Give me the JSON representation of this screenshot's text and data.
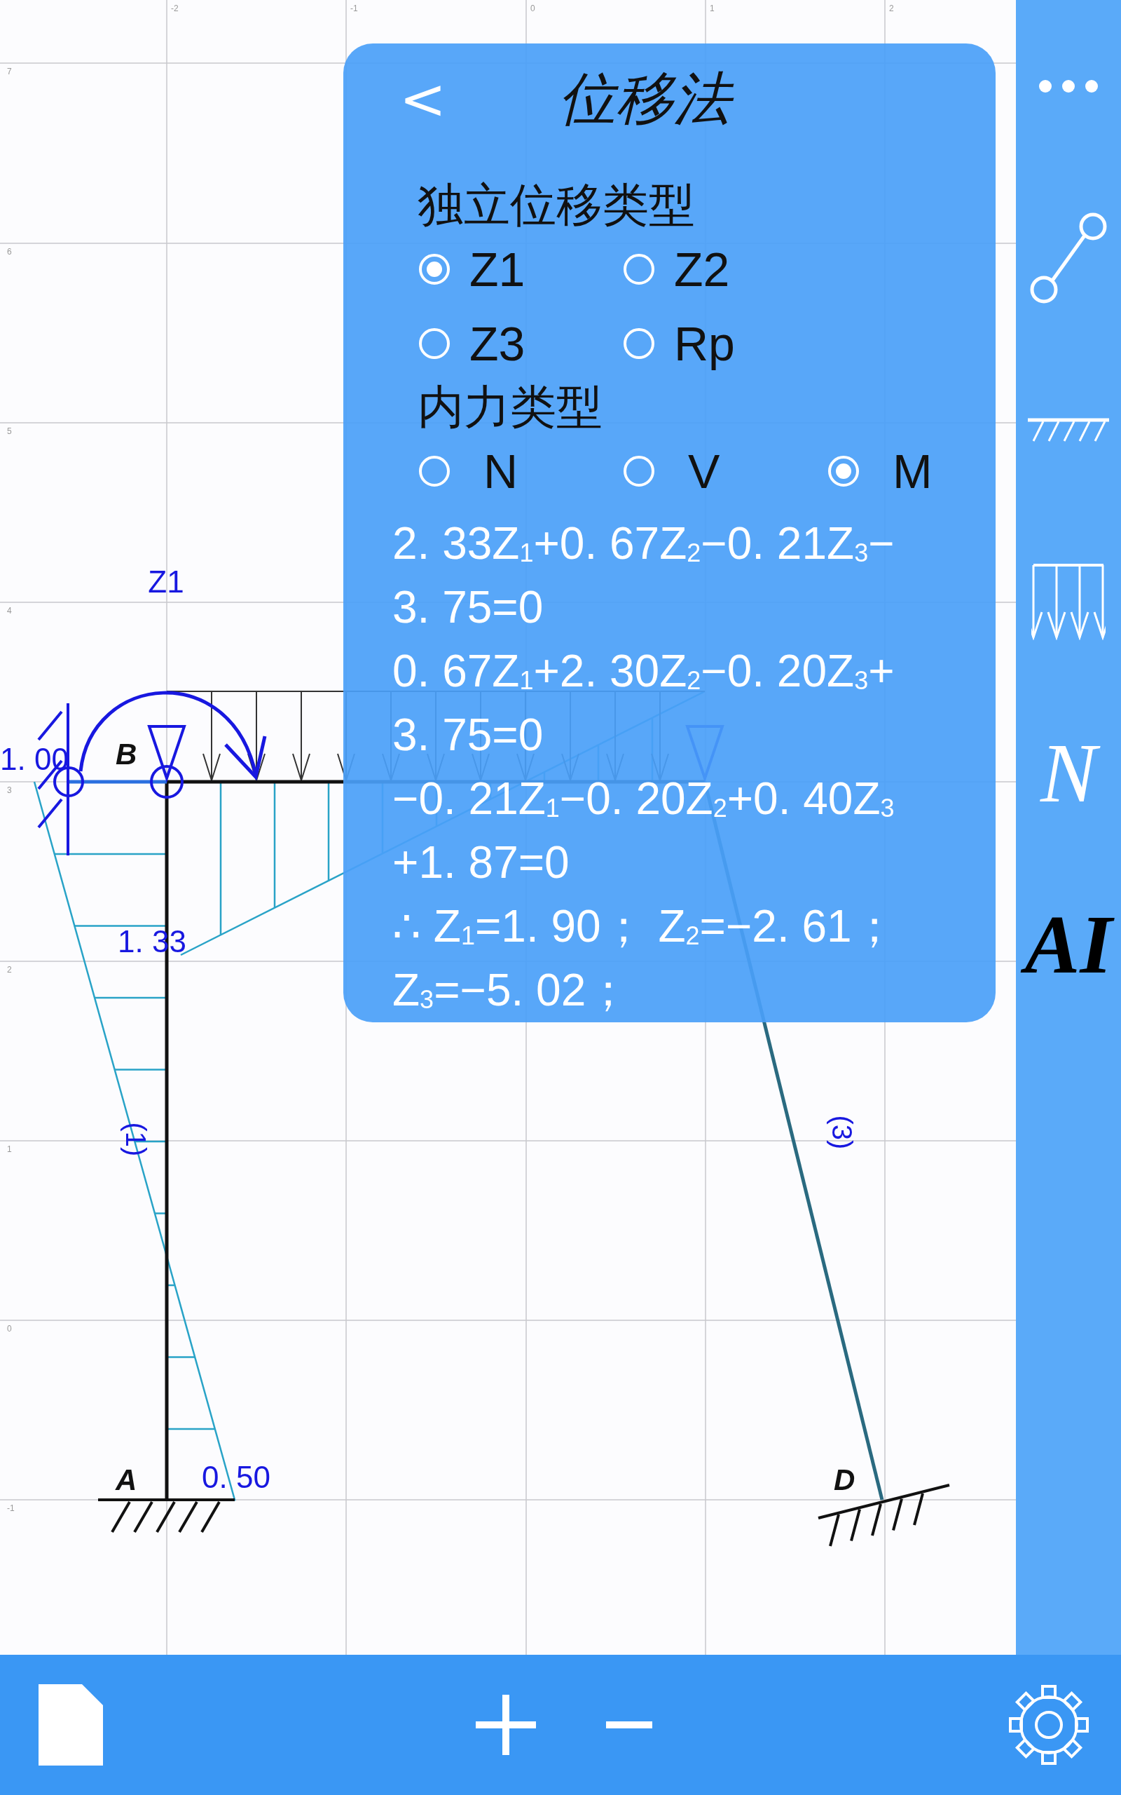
{
  "canvas": {
    "x_axis_labels": [
      "-2",
      "-1",
      "0",
      "1",
      "2"
    ],
    "y_axis_labels": [
      "7",
      "6",
      "5",
      "4",
      "3",
      "2",
      "1",
      "0",
      "-1"
    ],
    "node_labels": [
      "B",
      "A",
      "D"
    ],
    "member_labels": [
      "(1)",
      "(3)"
    ],
    "value_labels": [
      "Z1",
      "1. 00",
      "1. 33",
      "0. 50"
    ]
  },
  "panel": {
    "back": "<",
    "title": "位移法",
    "displacement_heading": "独立位移类型",
    "displacement_types": [
      {
        "label": "Z1",
        "selected": true
      },
      {
        "label": "Z2",
        "selected": false
      },
      {
        "label": "Z3",
        "selected": false
      },
      {
        "label": "Rp",
        "selected": false
      }
    ],
    "force_heading": "内力类型",
    "force_types": [
      {
        "label": "N",
        "selected": false
      },
      {
        "label": "V",
        "selected": false
      },
      {
        "label": "M",
        "selected": true
      }
    ],
    "equation_lines": [
      "2. 33Z$_{1}$+0. 67Z$_{2}$−0. 21Z$_{3}$−",
      "3. 75=0",
      "0. 67Z$_{1}$+2. 30Z$_{2}$−0. 20Z$_{3}$+",
      "3. 75=0",
      "−0. 21Z$_{1}$−0. 20Z$_{2}$+0. 40Z$_{3}$",
      "+1. 87=0",
      "∴ Z$_{1}$=1. 90； Z$_{2}$=−2. 61；",
      "Z$_{3}$=−5. 02；"
    ]
  },
  "toolbar": {
    "tools": [
      {
        "kind": "more"
      },
      {
        "kind": "member"
      },
      {
        "kind": "support"
      },
      {
        "kind": "load"
      },
      {
        "kind": "text",
        "label": "N"
      },
      {
        "kind": "ai",
        "label": "AI"
      }
    ]
  },
  "bottom_bar": {
    "buttons": [
      {
        "kind": "file"
      },
      {
        "kind": "zoom_in"
      },
      {
        "kind": "zoom_out"
      },
      {
        "kind": "settings"
      }
    ]
  }
}
